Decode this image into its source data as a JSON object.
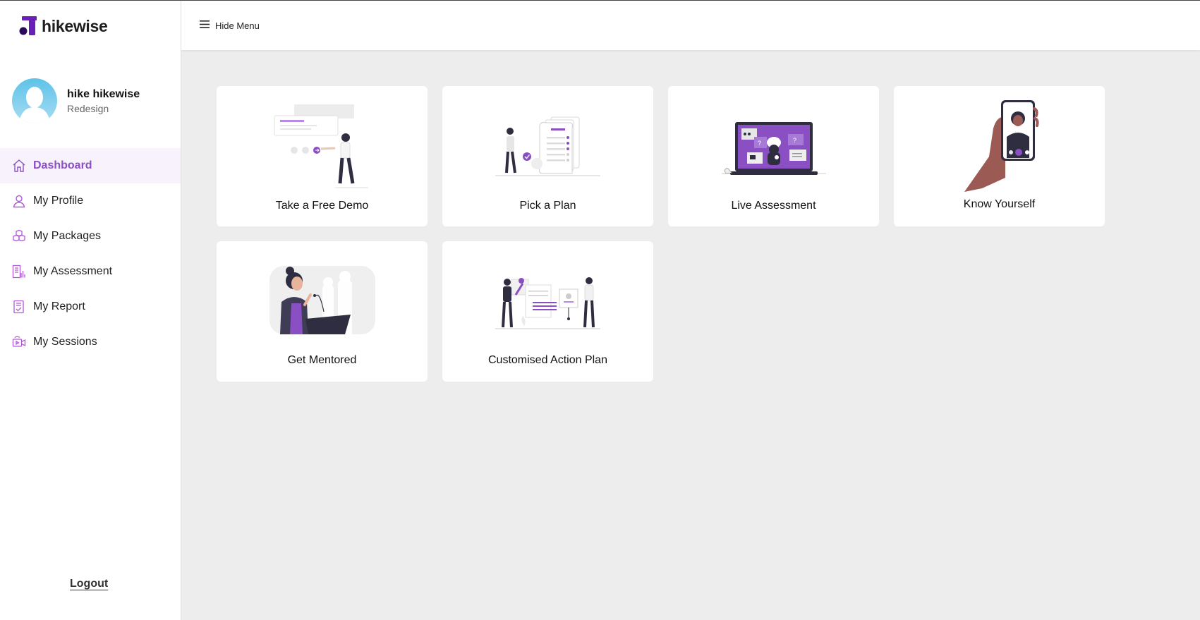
{
  "app": {
    "brand": "hikewise",
    "accent": "#8a4fc2",
    "logo_color": "#6a1fb8"
  },
  "user": {
    "name": "hike hikewise",
    "subtitle": "Redesign"
  },
  "sidebar": {
    "items": [
      {
        "label": "Dashboard",
        "icon": "home-icon",
        "active": true
      },
      {
        "label": "My Profile",
        "icon": "user-icon"
      },
      {
        "label": "My Packages",
        "icon": "package-icon"
      },
      {
        "label": "My Assessment",
        "icon": "assessment-icon"
      },
      {
        "label": "My Report",
        "icon": "report-icon"
      },
      {
        "label": "My Sessions",
        "icon": "video-session-icon"
      }
    ],
    "logout_label": "Logout"
  },
  "header": {
    "menu_label": "Hide Menu",
    "menu_icon": "hamburger-icon"
  },
  "cards": [
    {
      "label": "Take a Free Demo",
      "illustration": "demo-presentation-illustration"
    },
    {
      "label": "Pick a Plan",
      "illustration": "checklist-plan-illustration"
    },
    {
      "label": "Live Assessment",
      "illustration": "laptop-assessment-illustration"
    },
    {
      "label": "Know Yourself",
      "illustration": "phone-selfie-illustration"
    },
    {
      "label": "Get Mentored",
      "illustration": "speaker-podium-illustration"
    },
    {
      "label": "Customised Action Plan",
      "illustration": "team-planning-illustration"
    }
  ]
}
